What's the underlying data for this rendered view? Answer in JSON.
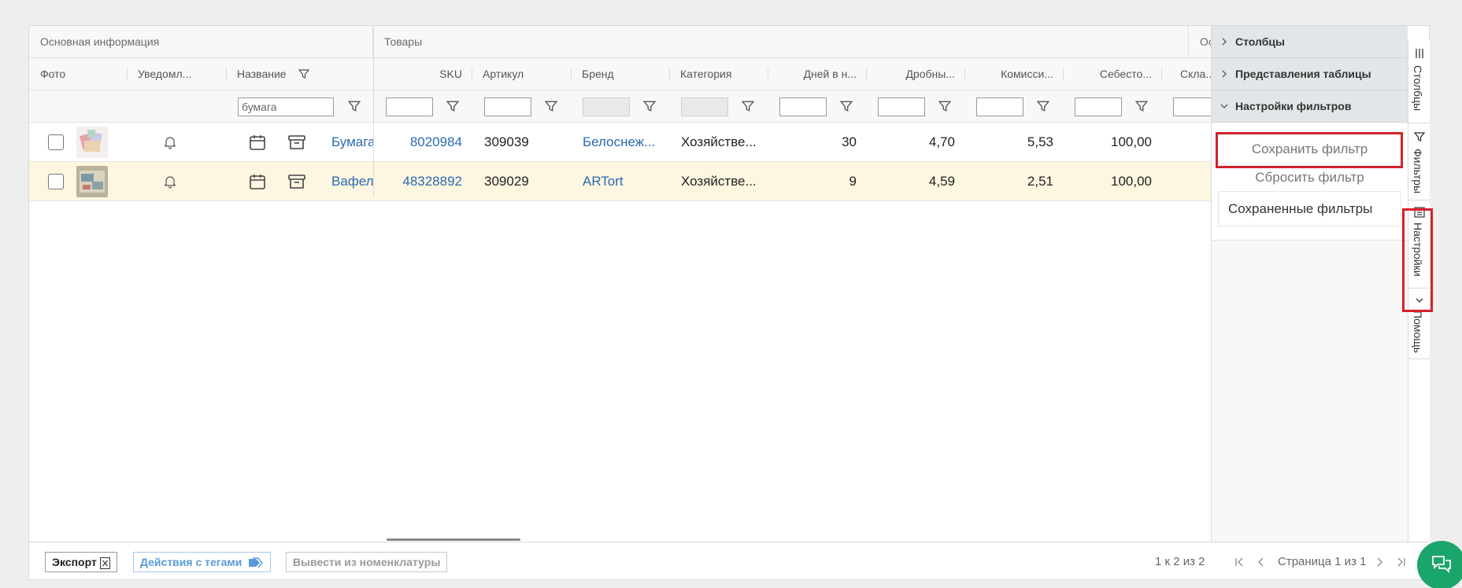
{
  "groups": {
    "main": "Основная информация",
    "goods": "Товары",
    "stock": "Остатки"
  },
  "columns": {
    "photo": "Фото",
    "notify": "Уведомл...",
    "name": "Название",
    "sku": "SKU",
    "article": "Артикул",
    "brand": "Бренд",
    "category": "Категория",
    "days": "Дней в н...",
    "fractional": "Дробны...",
    "commission": "Комисси...",
    "cost": "Себесто...",
    "warehouse": "Скла..."
  },
  "filters": {
    "name_value": "бумага"
  },
  "rows": [
    {
      "name": "Бумага",
      "sku": "8020984",
      "article": "309039",
      "brand": "Белоснеж...",
      "category": "Хозяйстве...",
      "days": "30",
      "fractional": "4,70",
      "commission": "5,53",
      "cost": "100,00"
    },
    {
      "name": "Вафель",
      "sku": "48328892",
      "article": "309029",
      "brand": "ARTort",
      "category": "Хозяйстве...",
      "days": "9",
      "fractional": "4,59",
      "commission": "2,51",
      "cost": "100,00"
    }
  ],
  "footer": {
    "export": "Экспорт",
    "tags": "Действия с тегами",
    "remove": "Вывести из номенклатуры",
    "count": "1 к 2 из 2",
    "page": "Страница 1 из 1"
  },
  "side_panel": {
    "columns": "Столбцы",
    "views": "Представления таблицы",
    "filter_settings": "Настройки фильтров",
    "save_filter": "Сохранить фильтр",
    "reset_filter": "Сбросить фильтр",
    "saved_filters": "Сохраненные фильтры"
  },
  "side_tabs": {
    "columns": "Столбцы",
    "filters": "Фильтры",
    "settings": "Настройки",
    "help": "Помощь"
  },
  "icons": [
    "filter-icon",
    "bell-icon",
    "calendar-icon",
    "archive-icon",
    "excel-icon",
    "tag-icon",
    "chevron-right-icon",
    "chevron-down-icon",
    "chat-icon"
  ],
  "colors": {
    "link": "#2a6ab0",
    "highlight_row": "#fdf6e0",
    "annotation_red": "#d6202a",
    "chat_green": "#1aa56a"
  }
}
